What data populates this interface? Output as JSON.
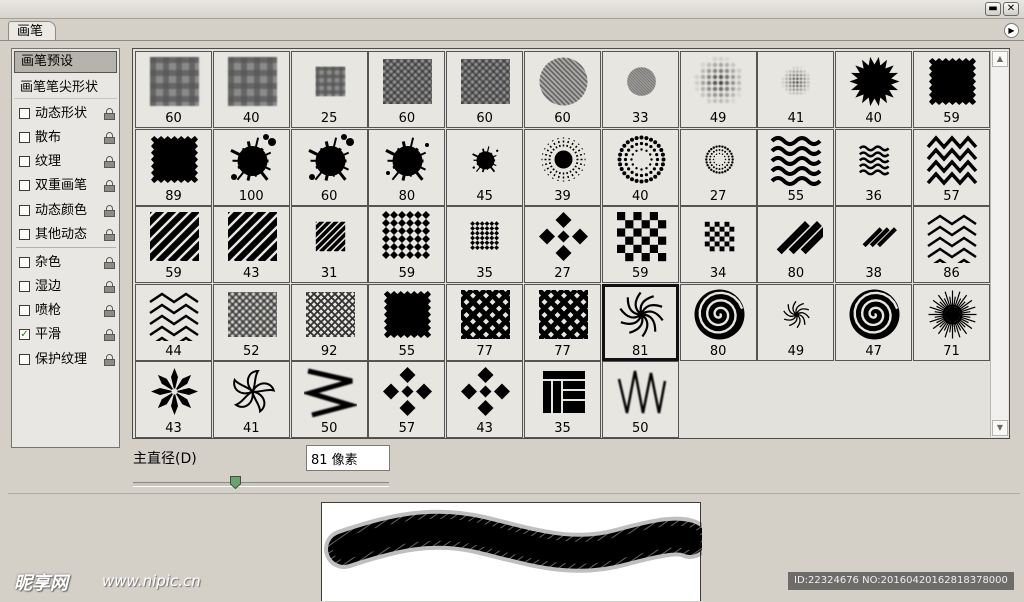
{
  "window": {
    "minimize_glyph": "▬",
    "close_glyph": "✕",
    "flyout_glyph": "▶"
  },
  "tab": {
    "label": "画笔"
  },
  "left_panel": {
    "preset_header": "画笔预设",
    "tip_shape_label": "画笔笔尖形状",
    "options": [
      {
        "label": "动态形状",
        "checked": false
      },
      {
        "label": "散布",
        "checked": false
      },
      {
        "label": "纹理",
        "checked": false
      },
      {
        "label": "双重画笔",
        "checked": false
      },
      {
        "label": "动态颜色",
        "checked": false
      },
      {
        "label": "其他动态",
        "checked": false
      },
      {
        "label": "杂色",
        "checked": false
      },
      {
        "label": "湿边",
        "checked": false
      },
      {
        "label": "喷枪",
        "checked": false
      },
      {
        "label": "平滑",
        "checked": true
      },
      {
        "label": "保护纹理",
        "checked": false
      }
    ],
    "check_glyph": "✓"
  },
  "brushes": [
    {
      "size": "60",
      "shape": "blur-plaid"
    },
    {
      "size": "40",
      "shape": "blur-plaid"
    },
    {
      "size": "25",
      "shape": "blur-plaid-small"
    },
    {
      "size": "60",
      "shape": "blur-crosshatch"
    },
    {
      "size": "60",
      "shape": "blur-crosshatch"
    },
    {
      "size": "60",
      "shape": "blur-diagonal"
    },
    {
      "size": "33",
      "shape": "blur-diagonal-small"
    },
    {
      "size": "49",
      "shape": "blur-dots"
    },
    {
      "size": "41",
      "shape": "blur-dots-small"
    },
    {
      "size": "40",
      "shape": "burst"
    },
    {
      "size": "59",
      "shape": "rough-square"
    },
    {
      "size": "89",
      "shape": "rough-square"
    },
    {
      "size": "100",
      "shape": "splatter"
    },
    {
      "size": "60",
      "shape": "splatter"
    },
    {
      "size": "80",
      "shape": "splat"
    },
    {
      "size": "45",
      "shape": "splat-small"
    },
    {
      "size": "39",
      "shape": "dot-burst"
    },
    {
      "size": "40",
      "shape": "dot-ring"
    },
    {
      "size": "27",
      "shape": "dot-ring-small"
    },
    {
      "size": "55",
      "shape": "waves"
    },
    {
      "size": "36",
      "shape": "waves-small"
    },
    {
      "size": "57",
      "shape": "zigzags"
    },
    {
      "size": "59",
      "shape": "stripes"
    },
    {
      "size": "43",
      "shape": "stripes"
    },
    {
      "size": "31",
      "shape": "stripes-small"
    },
    {
      "size": "59",
      "shape": "diamond-grid"
    },
    {
      "size": "35",
      "shape": "diamond-grid-small"
    },
    {
      "size": "27",
      "shape": "diamond-cross"
    },
    {
      "size": "59",
      "shape": "checker"
    },
    {
      "size": "34",
      "shape": "checker-small"
    },
    {
      "size": "80",
      "shape": "bars"
    },
    {
      "size": "38",
      "shape": "bars-small"
    },
    {
      "size": "86",
      "shape": "chevrons"
    },
    {
      "size": "44",
      "shape": "chevrons"
    },
    {
      "size": "52",
      "shape": "blur-net"
    },
    {
      "size": "92",
      "shape": "net"
    },
    {
      "size": "55",
      "shape": "rough-square"
    },
    {
      "size": "77",
      "shape": "weave"
    },
    {
      "size": "77",
      "shape": "weave"
    },
    {
      "size": "81",
      "shape": "swirl"
    },
    {
      "size": "80",
      "shape": "spiral"
    },
    {
      "size": "49",
      "shape": "swirl-small"
    },
    {
      "size": "47",
      "shape": "spiral"
    },
    {
      "size": "71",
      "shape": "sunburst"
    },
    {
      "size": "43",
      "shape": "flower"
    },
    {
      "size": "41",
      "shape": "pinwheel"
    },
    {
      "size": "50",
      "shape": "zig-vertical"
    },
    {
      "size": "57",
      "shape": "diamond-cross"
    },
    {
      "size": "43",
      "shape": "diamond-cross"
    },
    {
      "size": "35",
      "shape": "parquet"
    },
    {
      "size": "50",
      "shape": "zig-blur"
    }
  ],
  "selected_index": 39,
  "diameter": {
    "label": "主直径(D)",
    "value": "81 像素",
    "slider_fraction": 0.4
  },
  "watermark": {
    "logo": "昵享网",
    "url": "www.nipic.cn",
    "id_text": "ID:22324676 NO:20160420162818378000"
  }
}
